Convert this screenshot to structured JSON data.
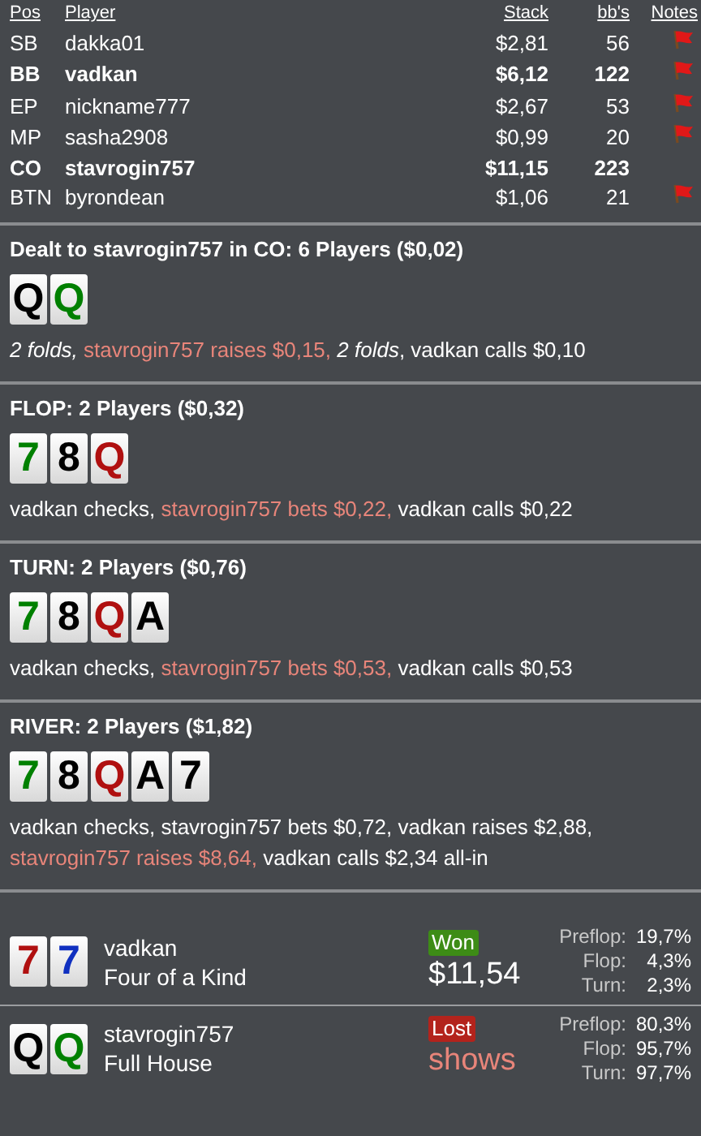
{
  "players": {
    "columns": [
      "Pos",
      "Player",
      "Stack",
      "bb's",
      "Notes"
    ],
    "rows": [
      {
        "pos": "SB",
        "player": "dakka01",
        "stack": "$2,81",
        "bbs": "56",
        "highlighted": false,
        "note": true
      },
      {
        "pos": "BB",
        "player": "vadkan",
        "stack": "$6,12",
        "bbs": "122",
        "highlighted": true,
        "note": true
      },
      {
        "pos": "EP",
        "player": "nickname777",
        "stack": "$2,67",
        "bbs": "53",
        "highlighted": false,
        "note": true
      },
      {
        "pos": "MP",
        "player": "sasha2908",
        "stack": "$0,99",
        "bbs": "20",
        "highlighted": false,
        "note": true
      },
      {
        "pos": "CO",
        "player": "stavrogin757",
        "stack": "$11,15",
        "bbs": "223",
        "highlighted": true,
        "note": false
      },
      {
        "pos": "BTN",
        "player": "byrondean",
        "stack": "$1,06",
        "bbs": "21",
        "highlighted": false,
        "note": true
      }
    ]
  },
  "streets": [
    {
      "heading": "Dealt to stavrogin757 in CO: 6 Players ($0,02)",
      "cards": [
        {
          "rank": "Q",
          "color": "#000000"
        },
        {
          "rank": "Q",
          "color": "#008000"
        }
      ],
      "actions": [
        {
          "text": "2 folds, ",
          "kind": "fold"
        },
        {
          "text": "stavrogin757 raises $0,15, ",
          "kind": "hero"
        },
        {
          "text": "2 folds",
          "kind": "fold"
        },
        {
          "text": ", vadkan calls $0,10",
          "kind": "plain"
        }
      ]
    },
    {
      "heading": "FLOP: 2 Players ($0,32)",
      "cards": [
        {
          "rank": "7",
          "color": "#008000"
        },
        {
          "rank": "8",
          "color": "#000000"
        },
        {
          "rank": "Q",
          "color": "#b01010"
        }
      ],
      "actions": [
        {
          "text": "vadkan checks, ",
          "kind": "plain"
        },
        {
          "text": "stavrogin757 bets $0,22, ",
          "kind": "hero"
        },
        {
          "text": "vadkan calls $0,22",
          "kind": "plain"
        }
      ]
    },
    {
      "heading": "TURN: 2 Players ($0,76)",
      "cards": [
        {
          "rank": "7",
          "color": "#008000"
        },
        {
          "rank": "8",
          "color": "#000000"
        },
        {
          "rank": "Q",
          "color": "#b01010"
        },
        {
          "rank": "A",
          "color": "#000000"
        }
      ],
      "actions": [
        {
          "text": "vadkan checks, ",
          "kind": "plain"
        },
        {
          "text": "stavrogin757 bets $0,53, ",
          "kind": "hero"
        },
        {
          "text": "vadkan calls $0,53",
          "kind": "plain"
        }
      ]
    },
    {
      "heading": "RIVER: 2 Players ($1,82)",
      "cards": [
        {
          "rank": "7",
          "color": "#008000"
        },
        {
          "rank": "8",
          "color": "#000000"
        },
        {
          "rank": "Q",
          "color": "#b01010"
        },
        {
          "rank": "A",
          "color": "#000000"
        },
        {
          "rank": "7",
          "color": "#000000"
        }
      ],
      "actions": [
        {
          "text": "vadkan checks, stavrogin757 bets $0,72, vadkan raises $2,88, ",
          "kind": "plain"
        },
        {
          "text": "stavrogin757 raises $8,64, ",
          "kind": "hero"
        },
        {
          "text": "vadkan calls $2,34 all-in",
          "kind": "plain"
        }
      ]
    }
  ],
  "results": [
    {
      "cards": [
        {
          "rank": "7",
          "color": "#b01010"
        },
        {
          "rank": "7",
          "color": "#1030c0"
        }
      ],
      "player": "vadkan",
      "hand": "Four of a Kind",
      "kind": "won",
      "badge": "Won",
      "amount": "$11,54",
      "equity": [
        {
          "label": "Preflop:",
          "value": "19,7%"
        },
        {
          "label": "Flop:",
          "value": "4,3%"
        },
        {
          "label": "Turn:",
          "value": "2,3%"
        }
      ]
    },
    {
      "cards": [
        {
          "rank": "Q",
          "color": "#000000"
        },
        {
          "rank": "Q",
          "color": "#008000"
        }
      ],
      "player": "stavrogin757",
      "hand": "Full House",
      "kind": "lost",
      "badge": "Lost",
      "amount": "shows",
      "equity": [
        {
          "label": "Preflop:",
          "value": "80,3%"
        },
        {
          "label": "Flop:",
          "value": "95,7%"
        },
        {
          "label": "Turn:",
          "value": "97,7%"
        }
      ]
    }
  ]
}
